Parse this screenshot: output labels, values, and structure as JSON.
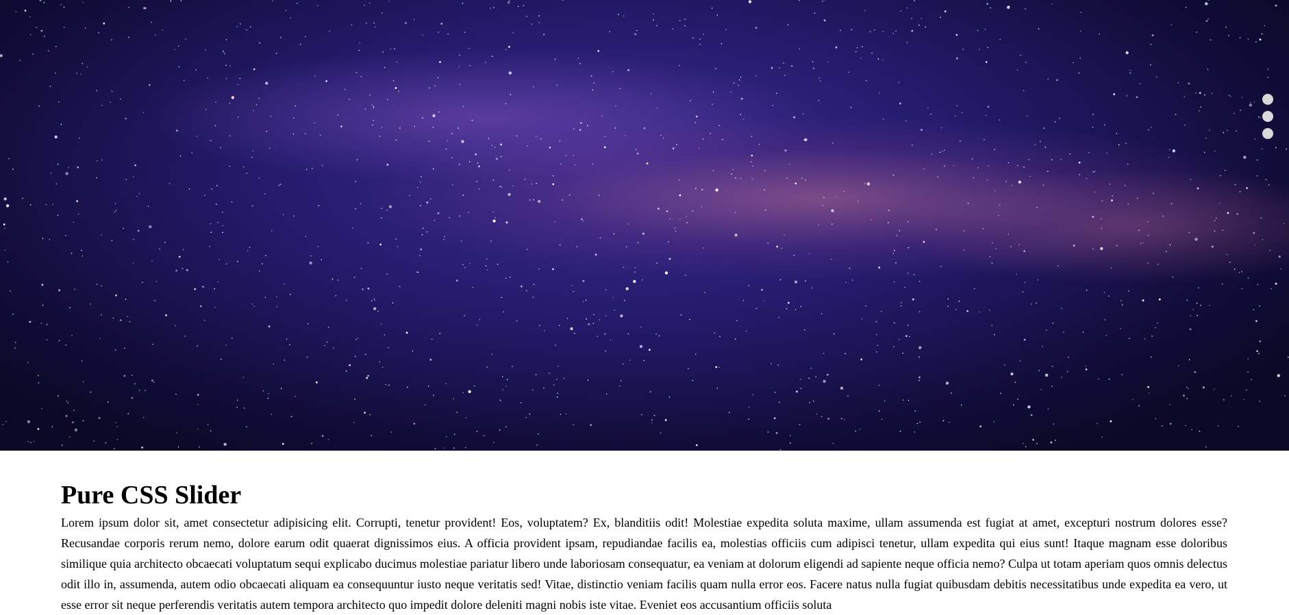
{
  "slider": {
    "slide_count": 3,
    "dot_color": "#d9d9d9",
    "image_description_name": "milky-way-starfield-image"
  },
  "article": {
    "title": "Pure CSS Slider",
    "body": "Lorem ipsum dolor sit, amet consectetur adipisicing elit. Corrupti, tenetur provident! Eos, voluptatem? Ex, blanditiis odit! Molestiae expedita soluta maxime, ullam assumenda est fugiat at amet, excepturi nostrum dolores esse? Recusandae corporis rerum nemo, dolore earum odit quaerat dignissimos eius. A officia provident ipsam, repudiandae facilis ea, molestias officiis cum adipisci tenetur, ullam expedita qui eius sunt! Itaque magnam esse doloribus similique quia architecto obcaecati voluptatum sequi explicabo ducimus molestiae pariatur libero unde laboriosam consequatur, ea veniam at dolorum eligendi ad sapiente neque officia nemo? Culpa ut totam aperiam quos omnis delectus odit illo in, assumenda, autem odio obcaecati aliquam ea consequuntur iusto neque veritatis sed! Vitae, distinctio veniam facilis quam nulla error eos. Facere natus nulla fugiat quibusdam debitis necessitatibus unde expedita ea vero, ut esse error sit neque perferendis veritatis autem tempora architecto quo impedit dolore deleniti magni nobis iste vitae. Eveniet eos accusantium officiis soluta"
  }
}
